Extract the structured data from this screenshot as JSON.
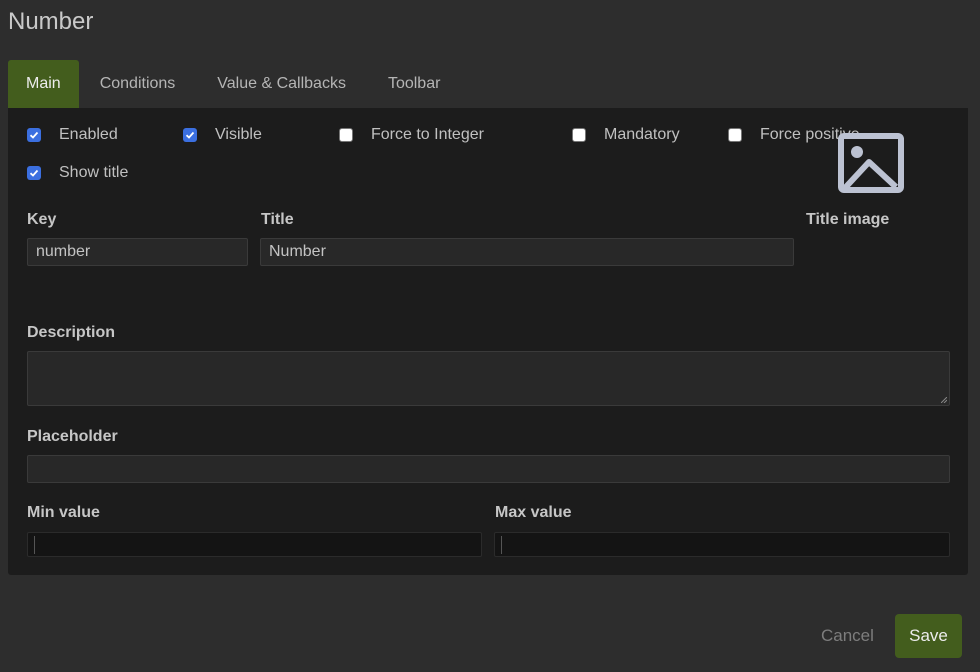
{
  "header": {
    "title": "Number"
  },
  "tabs": [
    {
      "label": "Main",
      "active": true
    },
    {
      "label": "Conditions",
      "active": false
    },
    {
      "label": "Value & Callbacks",
      "active": false
    },
    {
      "label": "Toolbar",
      "active": false
    }
  ],
  "checkboxes": {
    "enabled": {
      "label": "Enabled",
      "checked": true
    },
    "visible": {
      "label": "Visible",
      "checked": true
    },
    "force_integer": {
      "label": "Force to Integer",
      "checked": false
    },
    "mandatory": {
      "label": "Mandatory",
      "checked": false
    },
    "force_positive": {
      "label": "Force positive",
      "checked": false
    },
    "show_title": {
      "label": "Show title",
      "checked": true
    }
  },
  "fields": {
    "key": {
      "label": "Key",
      "value": "number"
    },
    "title": {
      "label": "Title",
      "value": "Number"
    },
    "title_image": {
      "label": "Title image",
      "icon": "image-placeholder-icon"
    },
    "description": {
      "label": "Description",
      "value": ""
    },
    "placeholder": {
      "label": "Placeholder",
      "value": ""
    },
    "min_value": {
      "label": "Min value",
      "value": ""
    },
    "max_value": {
      "label": "Max value",
      "value": ""
    }
  },
  "footer": {
    "cancel_label": "Cancel",
    "save_label": "Save"
  },
  "colors": {
    "accent": "#435d1d",
    "checkbox": "#3b6fe0",
    "panel": "#1c1c1c",
    "background": "#2d2d2d"
  }
}
